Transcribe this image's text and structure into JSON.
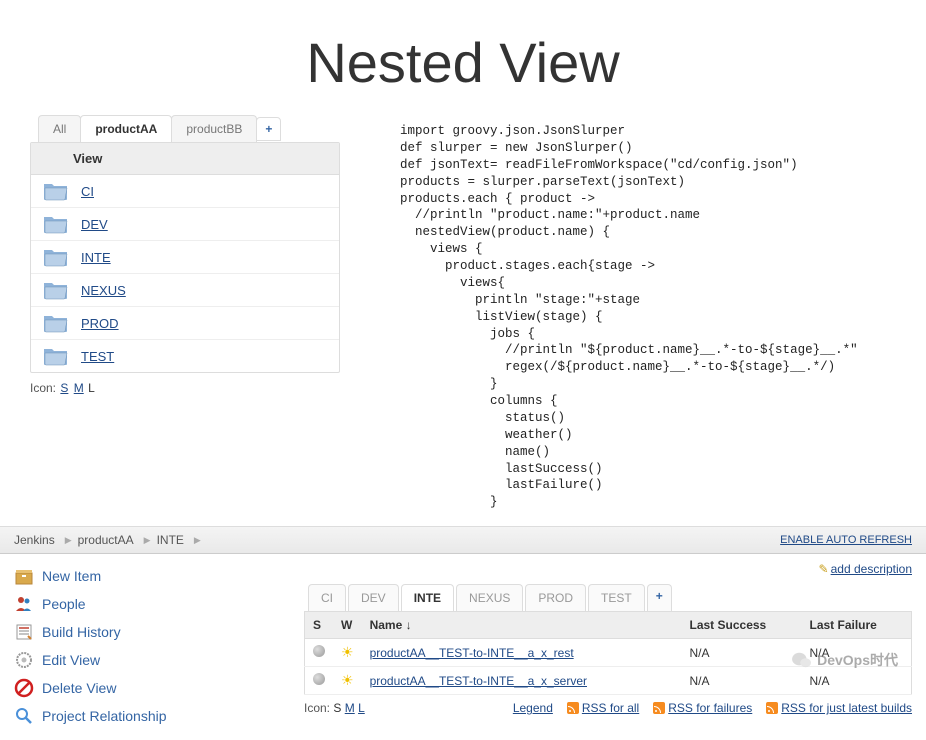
{
  "title": "Nested View",
  "tabs": {
    "all": "All",
    "a": "productAA",
    "b": "productBB",
    "add": "+"
  },
  "viewHeader": "View",
  "views": [
    "CI",
    "DEV",
    "INTE",
    "NEXUS",
    "PROD",
    "TEST"
  ],
  "iconLabel": "Icon:",
  "sizes": {
    "s": "S",
    "m": "M",
    "l": "L"
  },
  "code": "import groovy.json.JsonSlurper\ndef slurper = new JsonSlurper()\ndef jsonText= readFileFromWorkspace(\"cd/config.json\")\nproducts = slurper.parseText(jsonText)\nproducts.each { product ->\n  //println \"product.name:\"+product.name\n  nestedView(product.name) {\n    views {\n      product.stages.each{stage ->\n        views{\n          println \"stage:\"+stage\n          listView(stage) {\n            jobs {\n              //println \"${product.name}__.*-to-${stage}__.*\"\n              regex(/${product.name}__.*-to-${stage}__.*/)\n            }\n            columns {\n              status()\n              weather()\n              name()\n              lastSuccess()\n              lastFailure()\n            }",
  "breadcrumb": {
    "root": "Jenkins",
    "p1": "productAA",
    "p2": "INTE",
    "refresh": "ENABLE AUTO REFRESH"
  },
  "side": {
    "newItem": "New Item",
    "people": "People",
    "history": "Build History",
    "edit": "Edit View",
    "delete": "Delete View",
    "rel": "Project Relationship"
  },
  "addDesc": "add description",
  "subtabs": [
    "CI",
    "DEV",
    "INTE",
    "NEXUS",
    "PROD",
    "TEST"
  ],
  "cols": {
    "s": "S",
    "w": "W",
    "name": "Name ↓",
    "ls": "Last Success",
    "lf": "Last Failure"
  },
  "jobs": [
    {
      "name": "productAA__TEST-to-INTE__a_x_rest",
      "ls": "N/A",
      "lf": "N/A"
    },
    {
      "name": "productAA__TEST-to-INTE__a_x_server",
      "ls": "N/A",
      "lf": "N/A"
    }
  ],
  "footer": {
    "iconLabel": "Icon:",
    "legend": "Legend",
    "rssAll": "RSS for all",
    "rssFail": "RSS for failures",
    "rssLatest": "RSS for just latest builds"
  },
  "watermark": "DevOps时代"
}
